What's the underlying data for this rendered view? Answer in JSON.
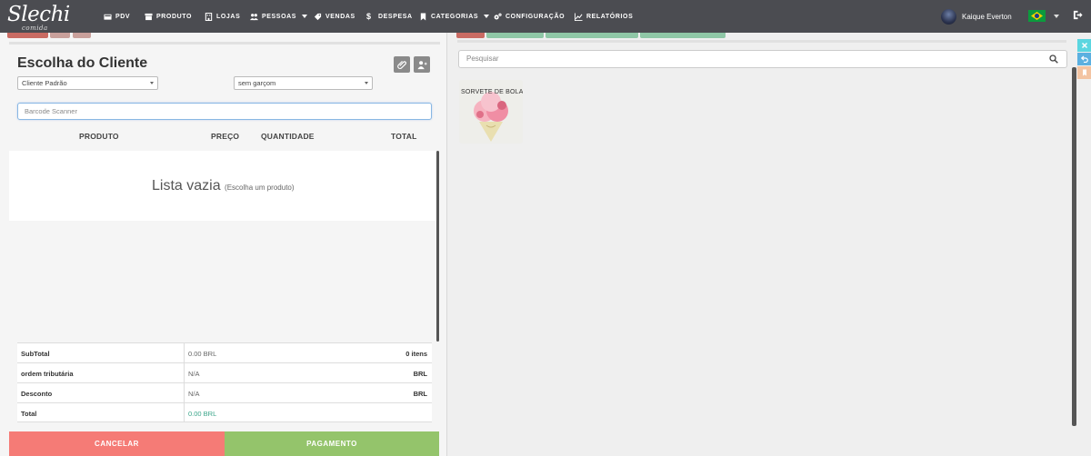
{
  "brand": {
    "name": "Slechi",
    "tagline": "comida"
  },
  "nav": {
    "items": [
      {
        "label": "PDV",
        "icon": "cash-register-icon",
        "dropdown": false
      },
      {
        "label": "PRODUTO",
        "icon": "box-icon",
        "dropdown": false
      },
      {
        "label": "LOJAS",
        "icon": "store-icon",
        "dropdown": false
      },
      {
        "label": "PESSOAS",
        "icon": "users-icon",
        "dropdown": true
      },
      {
        "label": "VENDAS",
        "icon": "tag-icon",
        "dropdown": false
      },
      {
        "label": "DESPESA",
        "icon": "dollar-icon",
        "dropdown": false
      },
      {
        "label": "CATEGORIAS",
        "icon": "bookmark-icon",
        "dropdown": true
      },
      {
        "label": "CONFIGURAÇÃO",
        "icon": "cogs-icon",
        "dropdown": false
      },
      {
        "label": "RELATÓRIOS",
        "icon": "chart-icon",
        "dropdown": false
      }
    ],
    "user_name": "Kaique Everton"
  },
  "pos": {
    "title": "Escolha do Cliente",
    "customer_select": "Cliente Padrão",
    "waiter_select": "sem garçom",
    "barcode_placeholder": "Barcode Scanner",
    "columns": {
      "product": "PRODUTO",
      "price": "PREÇO",
      "quantity": "QUANTIDADE",
      "total": "TOTAL"
    },
    "empty_main": "Lista vazia",
    "empty_sub": "(Escolha um produto)",
    "summary": {
      "subtotal_label": "SubTotal",
      "subtotal_value": "0.00 BRL",
      "items_count": "0 itens",
      "tax_label": "ordem tributária",
      "tax_value": "N/A",
      "tax_currency": "BRL",
      "discount_label": "Desconto",
      "discount_value": "N/A",
      "discount_currency": "BRL",
      "total_label": "Total",
      "total_value": "0.00 BRL"
    },
    "cancel_label": "CANCELAR",
    "pay_label": "PAGAMENTO"
  },
  "catalog": {
    "search_placeholder": "Pesquisar",
    "products": [
      {
        "name": "SORVETE DE BOLA"
      }
    ]
  },
  "colors": {
    "navbar": "#4b4c51",
    "cancel": "#f57b76",
    "pay": "#94c46b",
    "total_value": "#3aa58a",
    "side_tab_1": "#5bd6e0",
    "side_tab_2": "#5bb0e0",
    "side_tab_3": "#f3c4a2"
  }
}
